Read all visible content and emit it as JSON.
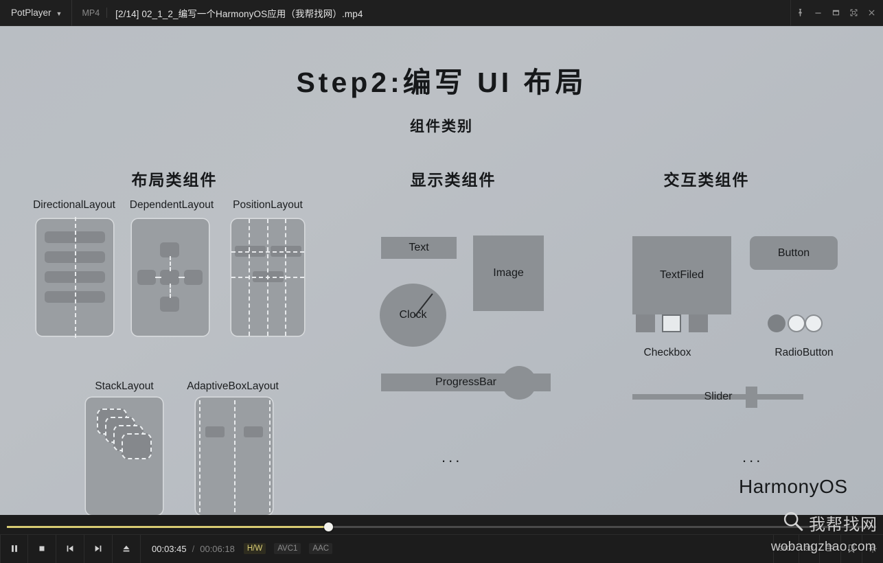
{
  "titlebar": {
    "app_name": "PotPlayer",
    "chevron_icon": "chevron-down-icon",
    "format": "MP4",
    "file_name": "[2/14] 02_1_2_编写一个HarmonyOS应用（我帮找网）.mp4",
    "buttons": [
      {
        "name": "pin-icon",
        "label": ""
      },
      {
        "name": "minimize-icon",
        "label": ""
      },
      {
        "name": "maximize-icon",
        "label": ""
      },
      {
        "name": "fullscreen-icon",
        "label": ""
      },
      {
        "name": "close-icon",
        "label": ""
      }
    ]
  },
  "slide": {
    "title": "Step2:编写 UI 布局",
    "subtitle": "组件类别",
    "columns": [
      {
        "heading": "布局类组件"
      },
      {
        "heading": "显示类组件"
      },
      {
        "heading": "交互类组件"
      }
    ],
    "layout_components": [
      {
        "label": "DirectionalLayout"
      },
      {
        "label": "DependentLayout"
      },
      {
        "label": "PositionLayout"
      },
      {
        "label": "StackLayout"
      },
      {
        "label": "AdaptiveBoxLayout"
      }
    ],
    "display_components": [
      {
        "label": "Text"
      },
      {
        "label": "Image"
      },
      {
        "label": "Clock"
      },
      {
        "label": "ProgressBar"
      }
    ],
    "interactive_components": [
      {
        "label": "TextFiled"
      },
      {
        "label": "Button"
      },
      {
        "label": "Checkbox"
      },
      {
        "label": "RadioButton"
      },
      {
        "label": "Slider"
      }
    ],
    "ellipsis_display": "...",
    "ellipsis_interactive": "...",
    "brand": "HarmonyOS"
  },
  "player": {
    "seek_percent": 37,
    "buttons": [
      {
        "name": "pause-button"
      },
      {
        "name": "stop-button"
      },
      {
        "name": "previous-button"
      },
      {
        "name": "next-button"
      },
      {
        "name": "eject-button"
      }
    ],
    "current_time": "00:03:45",
    "time_separator": "/",
    "total_time": "00:06:18",
    "hw_tag": "H/W",
    "video_codec": "AVC1",
    "audio_codec": "AAC",
    "right_buttons": [
      {
        "name": "vr360-button",
        "label": "360°"
      },
      {
        "name": "3d-button",
        "label": "3D"
      },
      {
        "name": "playlist-button",
        "label": ""
      },
      {
        "name": "bookmark-button",
        "label": ""
      },
      {
        "name": "settings-button",
        "label": ""
      }
    ]
  },
  "watermark": {
    "search_icon": "magnifier-icon",
    "cn_text": "我帮找网",
    "url_text": "wobangzhao.com"
  },
  "colors": {
    "slide_bg": "#bcc0c5",
    "panel": "#9a9ea2",
    "widget": "#8c9094",
    "accent": "#d8cb73",
    "titlebar_bg": "#1f1f1f"
  }
}
